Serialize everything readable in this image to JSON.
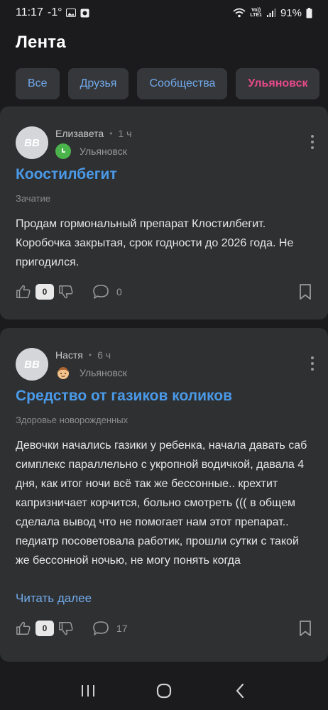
{
  "status": {
    "time": "11:17",
    "temp": "-1°",
    "lte": "LTE1",
    "vo": "Vo))",
    "battery": "91%"
  },
  "header": {
    "title": "Лента"
  },
  "filters": [
    "Все",
    "Друзья",
    "Сообщества",
    "Ульяновск"
  ],
  "active_filter": "Ульяновск",
  "posts": [
    {
      "avatar": "BB",
      "author": "Елизавета",
      "time": "1 ч",
      "location": "Ульяновск",
      "title": "Коостилбегит",
      "topic": "Зачатие",
      "body": "Продам гормональный препарат Клостилбегит. Коробочка закрытая, срок годности до 2026 года. Не пригодился.",
      "likes": "0",
      "comments": "0"
    },
    {
      "avatar": "BB",
      "author": "Настя",
      "time": "6 ч",
      "location": "Ульяновск",
      "title": "Средство от газиков коликов",
      "topic": "Здоровье новорожденных",
      "body": "Девочки начались газики у ребенка, начала давать саб симплекс параллельно с укропной водичкой, давала 4 дня, как итог ночи всё так же бессонные.. крехтит капризничает корчится, больно смотреть ((( в общем сделала вывод что не помогает нам этот препарат.. педиатр посоветовала работик, прошли сутки с такой же бессонной ночью, не могу понять когда",
      "read_more": "Читать далее",
      "likes": "0",
      "comments": "17"
    }
  ],
  "colors": {
    "accent": "#4a9ae8",
    "active_chip": "#e64a8a",
    "card": "#2f3032",
    "background": "#1b1b1d"
  },
  "icons": [
    "thumbs-up-icon",
    "thumbs-down-icon",
    "comment-icon",
    "bookmark-icon",
    "more-vertical-icon",
    "recent-apps-icon",
    "home-icon",
    "back-icon"
  ]
}
